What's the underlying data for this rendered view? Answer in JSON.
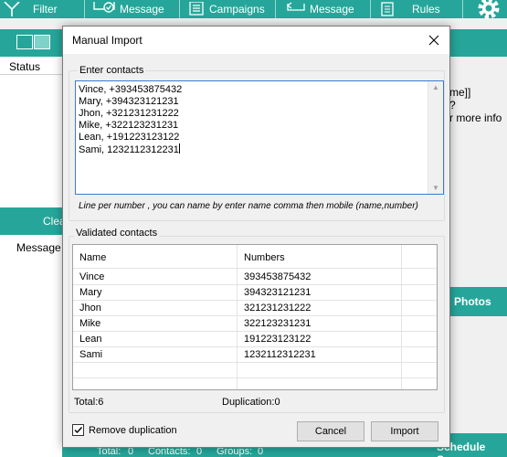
{
  "toolbar": {
    "items": [
      {
        "label": "Filter",
        "icon": "filter-icon"
      },
      {
        "label": "Message",
        "icon": "message-check-icon"
      },
      {
        "label": "Campaigns",
        "icon": "campaign-list-icon"
      },
      {
        "label": "Message",
        "icon": "reply-message-icon"
      },
      {
        "label": "Rules",
        "icon": "rules-icon"
      }
    ],
    "settings_icon": "gear-icon"
  },
  "background": {
    "status_header": "Status",
    "clear_label": "Clea",
    "message_header": "Message",
    "right_text": [
      "me]]",
      "?",
      "r more info"
    ],
    "photos_label": "Photos",
    "schedule_label": "Schedule Sen",
    "status_bar": {
      "total": "Total:",
      "total_value": "0",
      "contacts": "Contacts:",
      "contacts_value": "0",
      "groups": "Groups:",
      "groups_value": "0"
    }
  },
  "dialog": {
    "title": "Manual Import",
    "enter_label": "Enter contacts",
    "contacts_text": "Vince, +393453875432\nMary, +394323121231\nJhon, +321231231222\nMike, +322123231231\nLean, +191223123122\nSami, 1232112312231",
    "hint": "Line per number , you can name by enter name comma then mobile (name,number)",
    "validated_label": "Validated contacts",
    "columns": [
      "Name",
      "Numbers"
    ],
    "rows": [
      {
        "name": "Vince",
        "number": "393453875432"
      },
      {
        "name": "Mary",
        "number": "394323121231"
      },
      {
        "name": "Jhon",
        "number": "321231231222"
      },
      {
        "name": "Mike",
        "number": "322123231231"
      },
      {
        "name": "Lean",
        "number": "191223123122"
      },
      {
        "name": "Sami",
        "number": "1232112312231"
      }
    ],
    "total": "Total:6",
    "duplication": "Duplication:0",
    "remove_duplication_label": "Remove duplication",
    "remove_duplication_checked": true,
    "cancel_label": "Cancel",
    "import_label": "Import"
  },
  "colors": {
    "accent": "#26a69a",
    "focus_border": "#3a7bd5"
  }
}
